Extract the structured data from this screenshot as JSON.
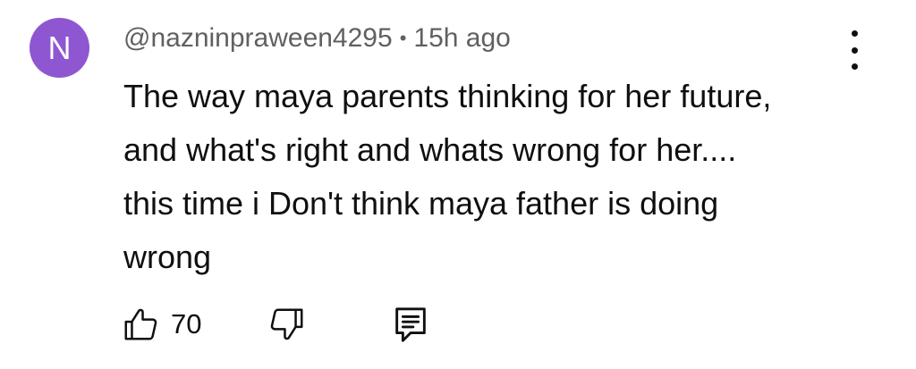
{
  "comment": {
    "avatar": {
      "initial": "N",
      "background_color": "#8e57d1"
    },
    "author": "@nazninpraween4295",
    "separator": "•",
    "time_ago": "15h ago",
    "body_lines": [
      "The way maya parents thinking for her future,",
      "and what's right and whats wrong for her....",
      "this time i Don't think maya father is doing",
      "wrong"
    ],
    "menu_icon": "more-vertical-icon",
    "actions": {
      "like_icon": "thumbs-up-icon",
      "like_count": "70",
      "dislike_icon": "thumbs-down-icon",
      "reply_icon": "reply-comment-icon"
    }
  }
}
